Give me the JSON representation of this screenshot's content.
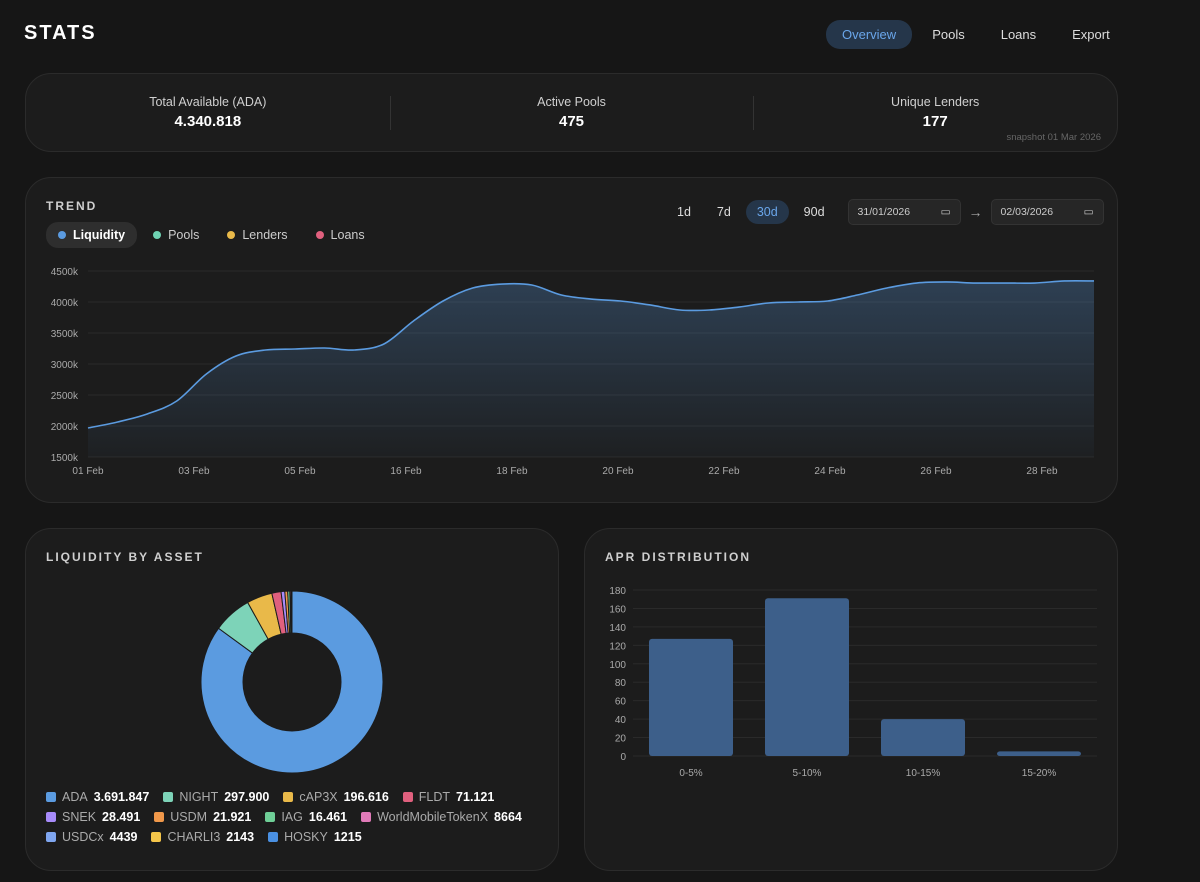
{
  "header": {
    "logo": "STATS",
    "nav": [
      "Overview",
      "Pools",
      "Loans",
      "Export"
    ],
    "active_nav": "Overview"
  },
  "stats": {
    "items": [
      {
        "label": "Total Available (ADA)",
        "value": "4.340.818"
      },
      {
        "label": "Active Pools",
        "value": "475"
      },
      {
        "label": "Unique Lenders",
        "value": "177"
      }
    ],
    "snapshot": "snapshot 01 Mar 2026"
  },
  "trend": {
    "title": "TREND",
    "series_toggles": [
      {
        "label": "Liquidity",
        "color": "#5b9be0"
      },
      {
        "label": "Pools",
        "color": "#6fd3b3"
      },
      {
        "label": "Lenders",
        "color": "#e9b949"
      },
      {
        "label": "Loans",
        "color": "#e0607e"
      }
    ],
    "ranges": [
      "1d",
      "7d",
      "30d",
      "90d"
    ],
    "active_range": "30d",
    "date_from": "31/01/2026",
    "date_to": "02/03/2026",
    "arrow": "→",
    "calendar_icon": "calendar-icon"
  },
  "chart_data": [
    {
      "type": "area",
      "title": "TREND",
      "series": [
        {
          "name": "Liquidity",
          "color": "#5b9be0",
          "values": [
            1968,
            2065,
            2194,
            2403,
            2839,
            3129,
            3226,
            3242,
            3258,
            3226,
            3323,
            3694,
            4016,
            4226,
            4290,
            4274,
            4113,
            4048,
            4016,
            3952,
            3871,
            3871,
            3919,
            3984,
            4000,
            4016,
            4113,
            4226,
            4306,
            4323,
            4306,
            4306,
            4306,
            4339,
            4339
          ]
        }
      ],
      "x_ticks": [
        "01 Feb",
        "03 Feb",
        "05 Feb",
        "16 Feb",
        "18 Feb",
        "20 Feb",
        "22 Feb",
        "24 Feb",
        "26 Feb",
        "28 Feb"
      ],
      "y_ticks": [
        "1500k",
        "2000k",
        "2500k",
        "3000k",
        "3500k",
        "4000k",
        "4500k"
      ],
      "ylim": [
        1500,
        4500
      ],
      "yunit": "k ADA"
    },
    {
      "type": "pie",
      "title": "LIQUIDITY BY ASSET",
      "donut": true,
      "slices": [
        {
          "label": "ADA",
          "value": 3691847,
          "display": "3.691.847",
          "color": "#5b9be0"
        },
        {
          "label": "NIGHT",
          "value": 297900,
          "display": "297.900",
          "color": "#7dd3b8"
        },
        {
          "label": "cAP3X",
          "value": 196616,
          "display": "196.616",
          "color": "#e9b949"
        },
        {
          "label": "FLDT",
          "value": 71121,
          "display": "71.121",
          "color": "#e0607e"
        },
        {
          "label": "SNEK",
          "value": 28491,
          "display": "28.491",
          "color": "#a78bfa"
        },
        {
          "label": "USDM",
          "value": 21921,
          "display": "21.921",
          "color": "#f0984a"
        },
        {
          "label": "IAG",
          "value": 16461,
          "display": "16.461",
          "color": "#6fcf97"
        },
        {
          "label": "WorldMobileTokenX",
          "value": 8664,
          "display": "8664",
          "color": "#e07ab8"
        },
        {
          "label": "USDCx",
          "value": 4439,
          "display": "4439",
          "color": "#7fa6f0"
        },
        {
          "label": "CHARLI3",
          "value": 2143,
          "display": "2143",
          "color": "#f5c64a"
        },
        {
          "label": "HOSKY",
          "value": 1215,
          "display": "1215",
          "color": "#4a90e2"
        }
      ]
    },
    {
      "type": "bar",
      "title": "APR DISTRIBUTION",
      "categories": [
        "0-5%",
        "5-10%",
        "10-15%",
        "15-20%"
      ],
      "values": [
        127,
        171,
        40,
        5
      ],
      "ylim": [
        0,
        180
      ],
      "y_ticks": [
        "0",
        "20",
        "40",
        "60",
        "80",
        "100",
        "120",
        "140",
        "160",
        "180"
      ],
      "color": "#3d5f8a"
    }
  ]
}
